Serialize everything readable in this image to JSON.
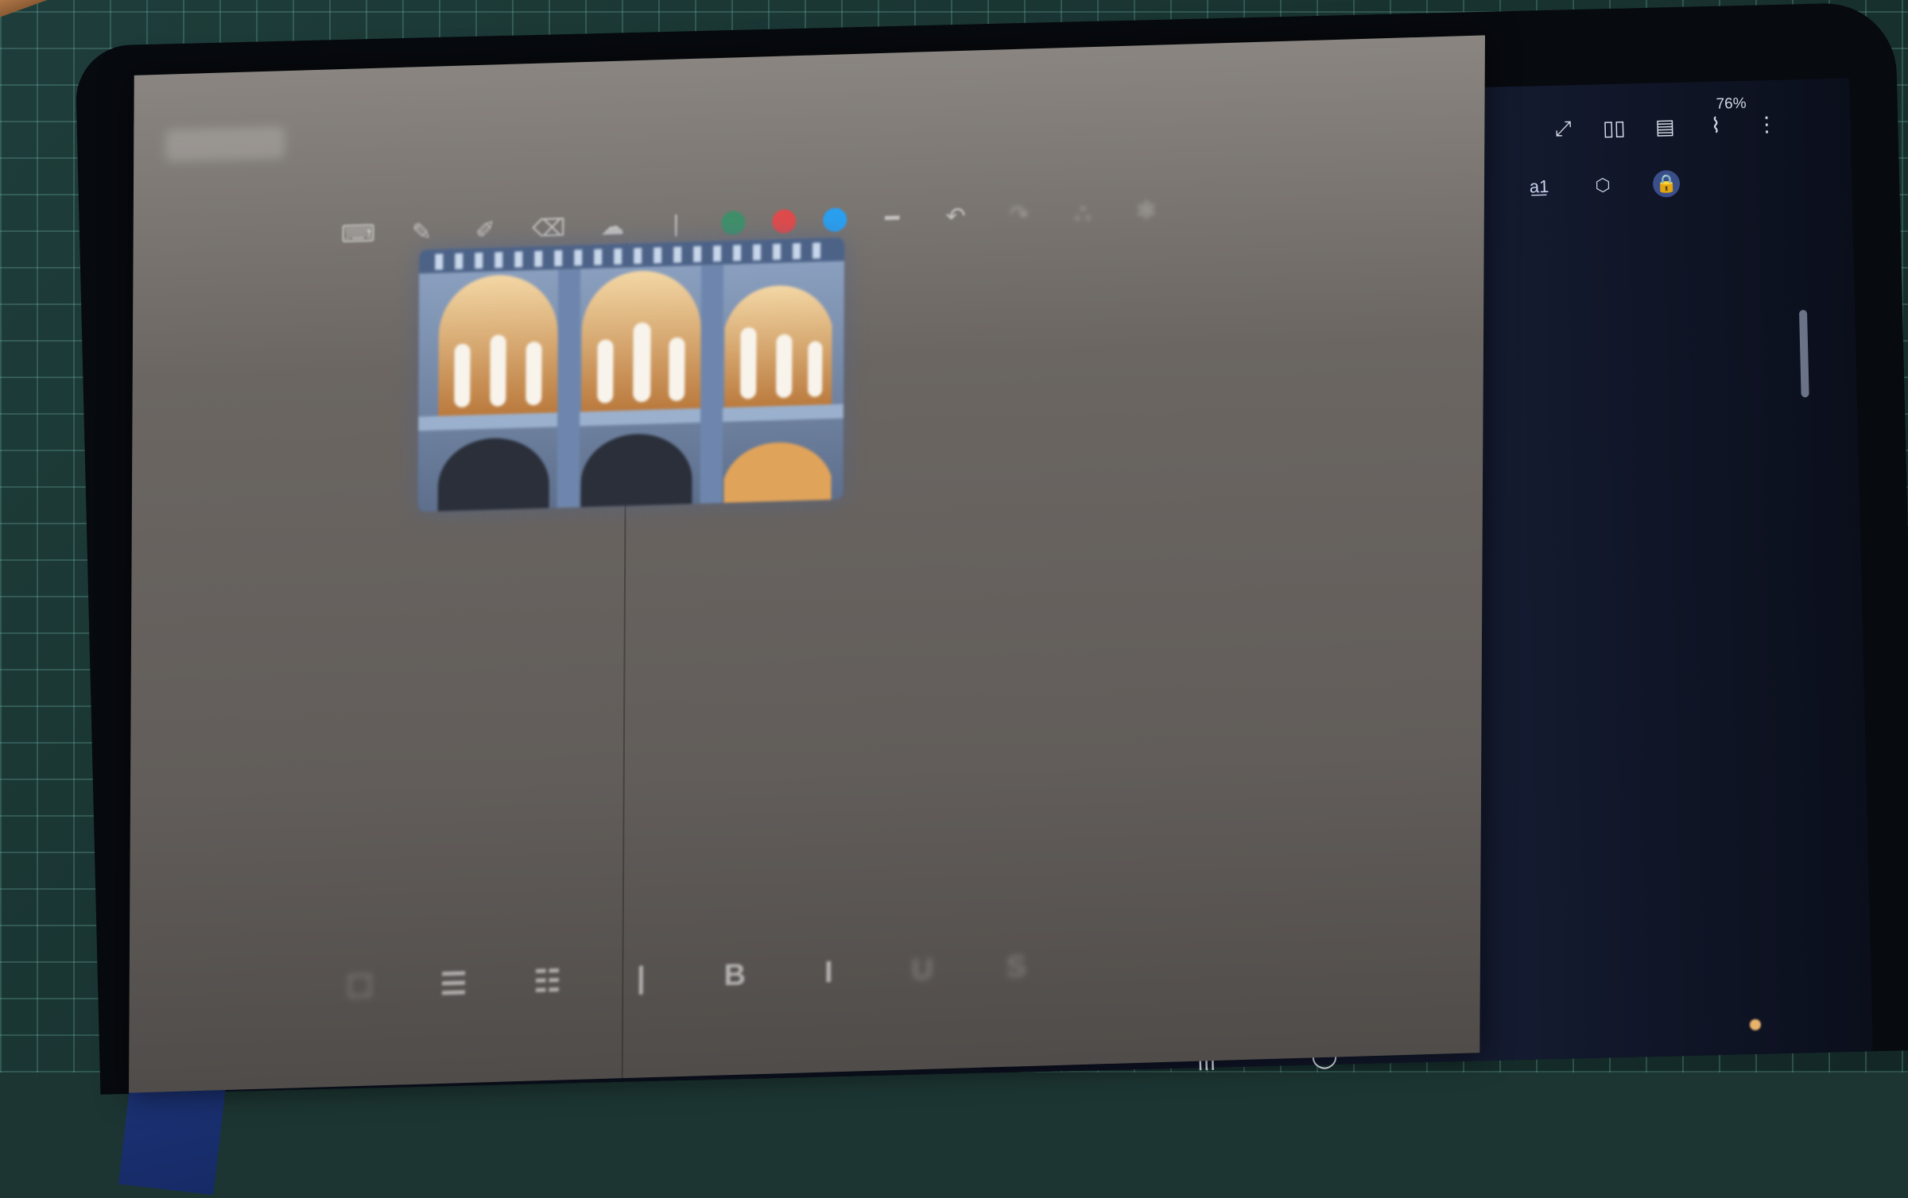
{
  "scene": {
    "status_bar": {
      "battery": "76%"
    },
    "right_toolbar": [
      {
        "icon": "expand-icon",
        "glyph": "⤢"
      },
      {
        "icon": "book-view-icon",
        "glyph": "▯▯"
      },
      {
        "icon": "note-icon",
        "glyph": "▤"
      },
      {
        "icon": "attach-icon",
        "glyph": "⌇"
      },
      {
        "icon": "more-icon",
        "glyph": "⋮"
      }
    ],
    "right_tools": [
      {
        "icon": "handwriting-icon",
        "glyph": "Ⓐ",
        "active": false
      },
      {
        "icon": "text-convert-icon",
        "glyph": "a͟1",
        "active": false
      },
      {
        "icon": "shapes-icon",
        "glyph": "⬡",
        "active": false
      },
      {
        "icon": "lock-layer-icon",
        "glyph": "🔒",
        "active": true
      }
    ],
    "paper_toolbar": {
      "tools": [
        {
          "icon": "keyboard-icon",
          "glyph": "⌨"
        },
        {
          "icon": "pen-icon",
          "glyph": "✎"
        },
        {
          "icon": "highlighter-icon",
          "glyph": "✐"
        },
        {
          "icon": "eraser-icon",
          "glyph": "⌫"
        },
        {
          "icon": "lasso-icon",
          "glyph": "☁"
        }
      ],
      "colors": [
        "#3f8f6a",
        "#e04a4a",
        "#2a9ff0"
      ],
      "after": [
        {
          "icon": "stroke-width-icon",
          "glyph": "━"
        },
        {
          "icon": "undo-icon",
          "glyph": "↶"
        },
        {
          "icon": "redo-icon",
          "glyph": "↷",
          "faded": true
        },
        {
          "icon": "pin-icon",
          "glyph": "⛬",
          "faded": true
        },
        {
          "icon": "settings-icon",
          "glyph": "✻",
          "faded": true
        }
      ]
    },
    "bottom_format": [
      {
        "icon": "checkbox-icon",
        "glyph": "☐",
        "faded": true
      },
      {
        "icon": "numbered-list-icon",
        "glyph": "☰"
      },
      {
        "icon": "bullet-list-icon",
        "glyph": "☷"
      },
      {
        "icon": "text-cursor-icon",
        "glyph": "|"
      },
      {
        "icon": "bold-icon",
        "glyph": "B"
      },
      {
        "icon": "italic-icon",
        "glyph": "I"
      },
      {
        "icon": "underline-icon",
        "glyph": "U",
        "faded": true
      },
      {
        "icon": "strikethrough-icon",
        "glyph": "S",
        "faded": true
      }
    ],
    "right_bottom": [
      {
        "icon": "align-icon",
        "glyph": "☰▾"
      },
      {
        "icon": "indent-icon",
        "glyph": "⇥"
      },
      {
        "icon": "outdent-icon",
        "glyph": "⇤"
      }
    ],
    "nav_bar": [
      {
        "icon": "recent-apps-icon",
        "glyph": "|||"
      },
      {
        "icon": "home-icon",
        "glyph": "◯"
      }
    ]
  }
}
